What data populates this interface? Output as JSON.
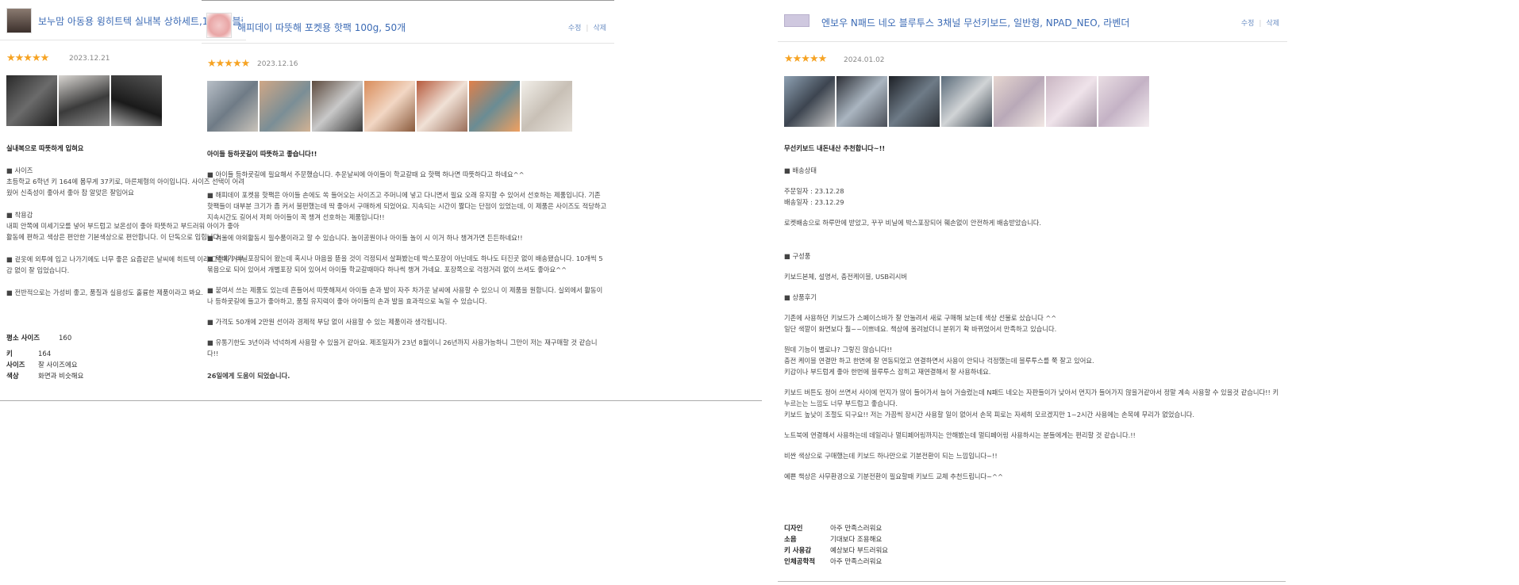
{
  "review1": {
    "product": "보누맘 아동용 윙히트텍 실내복 상하세트,160호,블랙",
    "date": "2023.12.21",
    "headline": "실내복으로 따뜻하게 입혀요",
    "paras": [
      "■ 사이즈\n    초등학교 6학년 키 164에 몸무게 37키로, 마른체형의 아이입니다. 사이즈 선택이 어려웠어 신축성이 좋아서 좋아 참 알맞은 잘입어요",
      "■ 착용감\n    내피 안쪽에 미세기모를 넣어 부드럽고 보온성이 좋아 따뜻하고 부드러워 아이가 좋아 활동에 편하고 색상은 편안한 기본색상으로 편안합니다. 이 단독으로 입힙니다.",
      "■ 겉옷에 외투에 입고 나가기에도 너무 좋은 요즘같은 날씨에 히트텍 이라 그런지 거부감 없이 잘 입었습니다.",
      "■ 전반적으로는 가성비 좋고, 품질과 실용성도 훌륭한 제품이라고 봐요."
    ],
    "ratings": [
      {
        "k": "평소 사이즈",
        "v": "160"
      },
      {
        "k": "키",
        "v": "164"
      },
      {
        "k": "사이즈",
        "v": "잘 사이즈에요"
      },
      {
        "k": "색상",
        "v": "화면과 비슷해요"
      }
    ]
  },
  "review2": {
    "product": "해피데이 따뜻해 포켓용 핫팩 100g, 50개",
    "edit": "수정",
    "delete": "삭제",
    "date": "2023.12.16",
    "headline": "아이들 등하굣길이 따뜻하고 좋습니다!!",
    "paras": [
      "■ 아이들 등하굣길에 필요해서 주문했습니다. 추운날씨에 아이들이 학교갈때 요 핫팩 하나면 따뜻하다고 하네요^^",
      "■ 해피데이 포켓용 핫팩은 아이들 손에도 쏙 들어오는 사이즈고 주머니에 넣고 다니면서 필요 오래 유지할 수 있어서 선호하는 제품입니다. 기존 핫팩들이 대부분 크기가 좀 커서 불편했는데 딱 좋아서 구매하게 되었어요. 지속되는 시간이 짧다는 단점이 있었는데, 이 제품은 사이즈도 적당하고 지속시간도 길어서 저희 아이들이 꼭 챙겨 선호하는 제품입니다!!",
      "■ 겨울에 야외활동시 필수품이라고 할 수 있습니다. 놀이공원이나 아이들 놀이 시 이거 하나 챙겨가면 든든하네요!!",
      "■ 택배가 비닐포장되어 왔는데 혹시나 마음을 뜯을 것이 걱정되서 살펴봤는데 박스포장이 아닌데도 하나도 터진곳 없이 배송됐습니다. 10개씩 5묶음으로 되어 있어서 개별포장 되어 있어서 아이들 학교갈때마다 하나씩 챙겨 가네요. 포장쪽으로 걱정거리 없이 쓰셔도 좋아요^^",
      "■ 붙여서 쓰는 제품도 있는데 흔들어서 따뜻해져서 아이들 손과 발이 자주 차가운 날씨에 사용할 수 있으니 이 제품을 원합니다. 실외에서 활동이나 등하굣길에 들고가 좋아하고, 품질 유지력이 좋아 아이들의 손과 발을 효과적으로 녹일 수 있습니다.",
      "■ 가격도 50개에 2만원 선이라 경제적 부담 없이 사용할 수 있는 제품이라 생각됩니다.",
      "■ 유통기한도 3년이라 넉넉하게 사용할 수 있을거 같아요. 제조일자가 23년 8월이니 26년까지 사용가능하니 그만이 저는 재구매할 것 같습니다!!",
      "26일에게 도움이 되었습니다."
    ]
  },
  "review3": {
    "product": "엔보우 N패드 네오 블루투스 3채널 무선키보드, 일반형, NPAD_NEO, 라벤더",
    "edit": "수정",
    "delete": "삭제",
    "date": "2024.01.02",
    "headline": "무선키보드 내돈내산 추천합니다~!!",
    "paras": [
      "■ 배송상태",
      "주문일자 : 23.12.28\n배송일자 : 23.12.29",
      "로켓배송으로 하루만에 받았고, 꾸꾸 비닐에 박스포장되어 훼손없이 안전하게 배송받았습니다.",
      "■ 구성품",
      "키보드본체, 설명서, 충전케이블, USB리시버",
      "■ 상품후기",
      "기존에 사용하던 키보드가 스페이스바가 잘 안눌려서 새로 구매해 보는데 색상 선물로 샀습니다 ^^\n일단 색깔이 화면보다 훨~~이쁘네요. 책상에 올려놨더니 분위기 확 바뀌었어서 만족하고 있습니다.",
      "뭔데 기능이 별로냐? 그렇진 않습니다!!\n충전 케이블 연결만 하고 한번에 잘 연동되었고 연결하면서 사용이 안되나 걱정했는데 블루투스를 쭉 잘고 있어요.\n키감이나 부드럽게 좋아 한번에 블루투스 잡히고 재연결해서 잘 사용하네요.",
      "키보드 버튼도 정어 쓰면서 사이에 먼지가 많이 들어가서 늘어 거슬렸는데 N패드 네오는 자판들이가 낮아서 먼지가 들어가지 않을거같아서 정말 계속 사용할 수 있을것 같습니다!! 키 누르는는 느낌도 너무 부드럽고 좋습니다.\n키보드 높낮이 조절도 되구요!! 저는 가끔씩 장시간 사용할 일이 없어서 손목 피로는 자세히 모르겠지만 1~2시간 사용에는 손목에 무리가 없었습니다.",
      "노트북에 연결해서 사용하는데 데일리나 멀티페어링까지는 안해봤는데 멀티페어링 사용하시는 분들에게는 편리할 것 같습니다.!!",
      "비싼 색상으로 구매했는데 키보드 하나만으로 기분전환이 되는 느낌입니다~!!",
      "예쁜 책상은 사무환경으로 기분전환이 필요할때 키보드 교체 추천드립니다~^^"
    ],
    "ratings": [
      {
        "k": "디자인",
        "v": "아주 만족스러워요"
      },
      {
        "k": "소음",
        "v": "기대보다 조용해요"
      },
      {
        "k": "키 사용감",
        "v": "예상보다 부드러워요"
      },
      {
        "k": "인체공학적",
        "v": "아주 만족스러워요"
      }
    ]
  },
  "rating_stars": "★★★★★",
  "colors": {
    "link": "#3c6bb5",
    "star": "#f6a323"
  }
}
